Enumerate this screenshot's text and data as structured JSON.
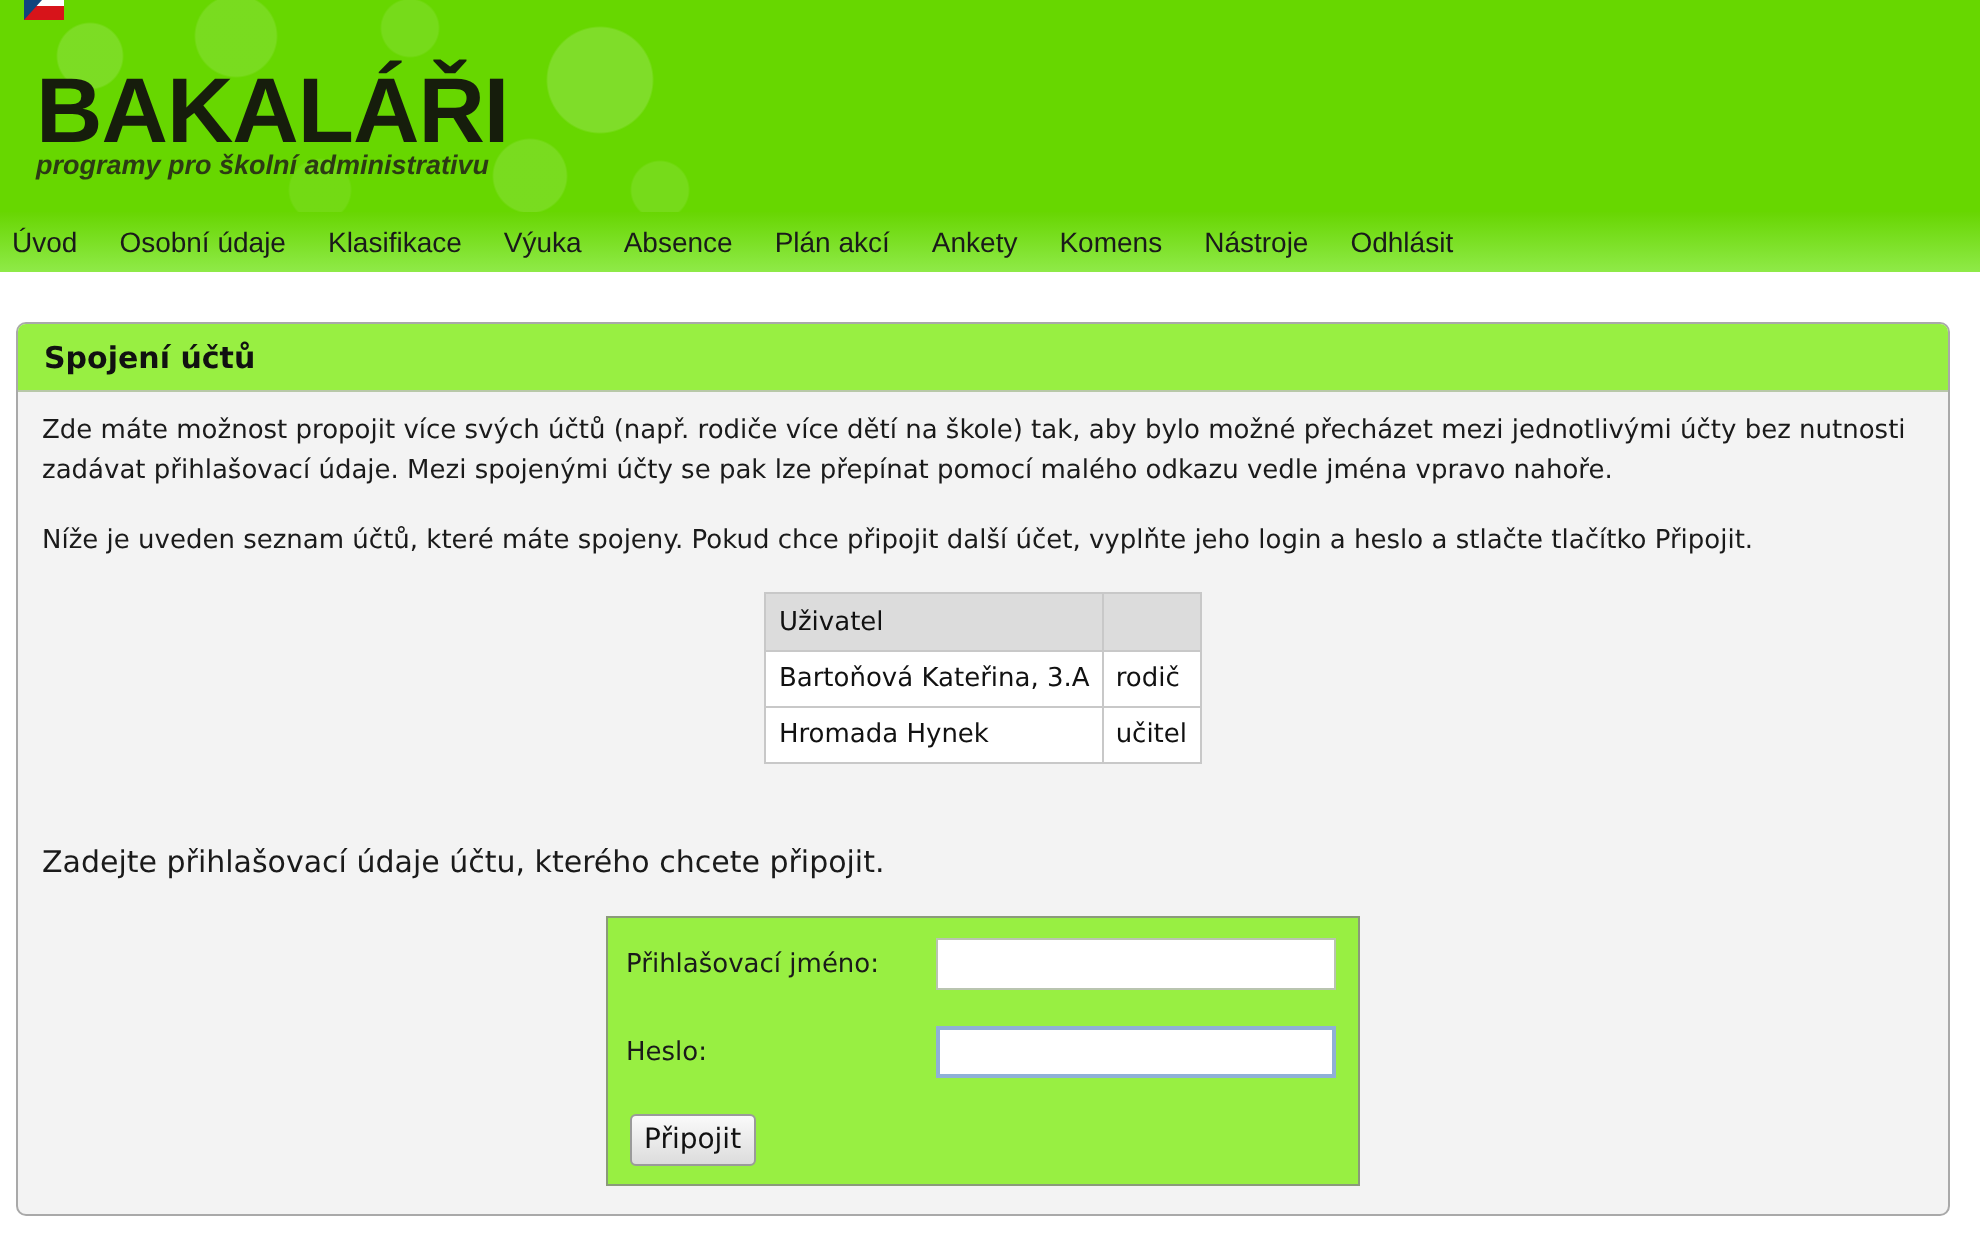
{
  "header": {
    "logo": {
      "title": "BAKALÁŘI",
      "subtitle": "programy pro školní administrativu"
    }
  },
  "nav": {
    "items": [
      "Úvod",
      "Osobní údaje",
      "Klasifikace",
      "Výuka",
      "Absence",
      "Plán akcí",
      "Ankety",
      "Komens",
      "Nástroje",
      "Odhlásit"
    ]
  },
  "panel": {
    "title": "Spojení účtů",
    "paragraphs": [
      "Zde máte možnost propojit více svých účtů (např. rodiče více dětí na škole) tak, aby bylo možné přecházet mezi jednotlivými účty bez nutnosti zadávat přihlašovací údaje. Mezi spojenými účty se pak lze přepínat pomocí malého odkazu vedle jména vpravo nahoře.",
      "Níže je uveden seznam účtů, které máte spojeny. Pokud chce připojit další účet, vyplňte jeho login a heslo a stlačte tlačítko Připojit."
    ],
    "table": {
      "columns": [
        "Uživatel"
      ],
      "rows": [
        [
          "Bartoňová Kateřina, 3.A",
          "rodič"
        ],
        [
          "Hromada Hynek",
          "učitel"
        ]
      ]
    },
    "prompt": "Zadejte přihlašovací údaje účtu, kterého chcete připojit.",
    "form": {
      "fields": [
        {
          "label": "Přihlašovací jméno:",
          "focused": false
        },
        {
          "label": "Heslo:",
          "focused": true
        }
      ],
      "submit": "Připojit"
    }
  }
}
